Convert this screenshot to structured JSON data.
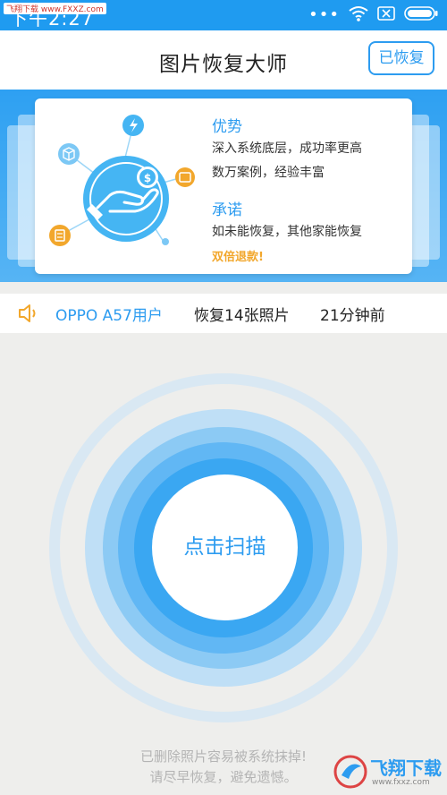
{
  "status_bar": {
    "time": "下午2:27",
    "watermark": "飞翔下载 www.FXXZ.com",
    "icons": [
      "more-dots",
      "wifi-icon",
      "close-box-icon",
      "battery-icon"
    ]
  },
  "header": {
    "title": "图片恢复大师",
    "recovered_button": "已恢复"
  },
  "promo": {
    "advantage_title": "优势",
    "advantage_line1": "深入系统底层，成功率更高",
    "advantage_line2": "数万案例，经验丰富",
    "promise_title": "承诺",
    "promise_line1": "如未能恢复，其他家能恢复",
    "promise_highlight": "双倍退款!"
  },
  "notice": {
    "user": "OPPO A57用户",
    "action": "恢复14张照片",
    "time": "21分钟前"
  },
  "scan": {
    "button_label": "点击扫描"
  },
  "footer": {
    "line1": "已删除照片容易被系统抹掉!",
    "line2": "请尽早恢复，避免遗憾。"
  },
  "brand_watermark": {
    "text": "飞翔下载",
    "url": "www.fxxz.com"
  },
  "colors": {
    "primary": "#2d9cf0",
    "status_bar": "#1f9bf0",
    "accent_orange": "#f2a72c"
  }
}
